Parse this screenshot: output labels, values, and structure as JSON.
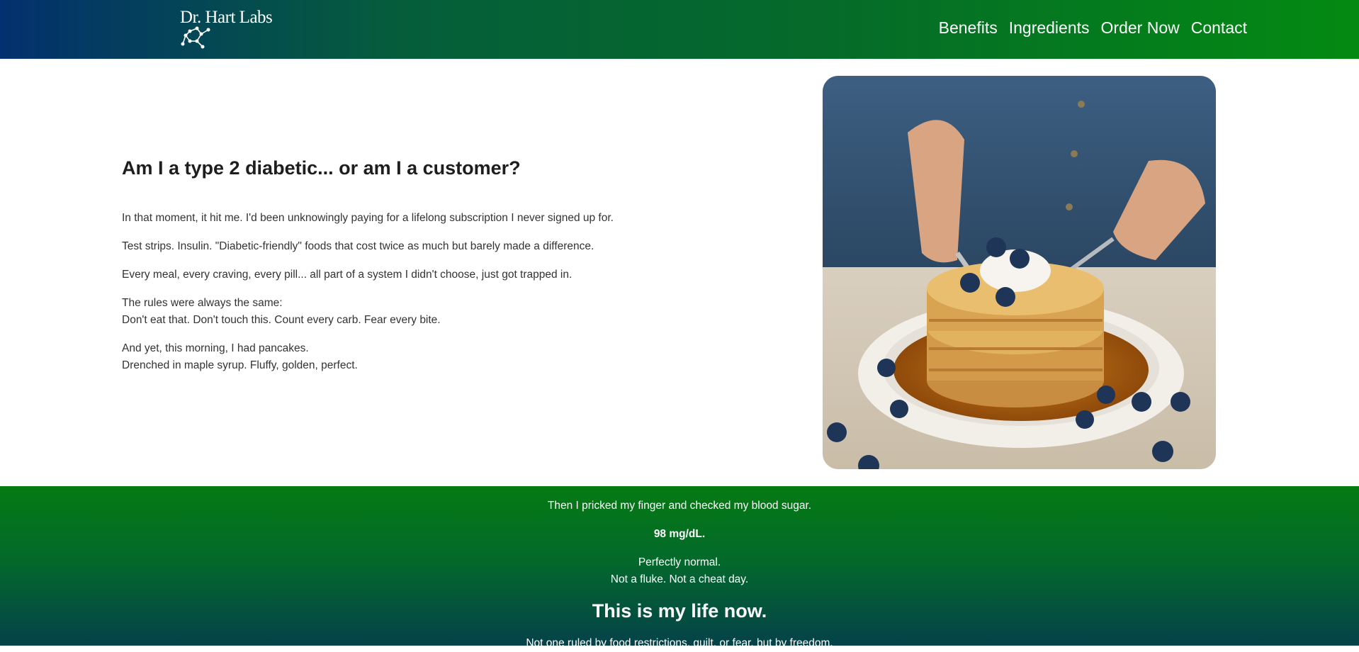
{
  "brand": {
    "logo_text": "Dr. Hart Labs",
    "colors": {
      "header_start": "#03306e",
      "header_end": "#048a12",
      "band_top": "#047a12",
      "band_bottom": "#04424a"
    }
  },
  "nav": {
    "items": [
      {
        "label": "Benefits"
      },
      {
        "label": "Ingredients"
      },
      {
        "label": "Order Now"
      },
      {
        "label": "Contact"
      }
    ]
  },
  "hero": {
    "title": "Am I a type 2 diabetic... or am I a customer?",
    "p1": "In that moment, it hit me. I'd been unknowingly paying for a lifelong subscription I never signed up for.",
    "p2": "Test strips. Insulin. \"Diabetic-friendly\" foods that cost twice as much but barely made a difference.",
    "p3": "Every meal, every craving, every pill... all part of a system I didn't choose, just got trapped in.",
    "p4_line1": "The rules were always the same:",
    "p4_line2": "Don't eat that. Don't touch this. Count every carb. Fear every bite.",
    "p5_line1": "And yet, this morning, I had pancakes.",
    "p5_line2": "Drenched in maple syrup. Fluffy, golden, perfect.",
    "image_icon": "pancakes-photo"
  },
  "band": {
    "line1": "Then I pricked my finger and checked my blood sugar.",
    "reading": "98 mg/dL.",
    "normal1": "Perfectly normal.",
    "normal2": "Not a fluke. Not a cheat day.",
    "headline": "This is my life now.",
    "tail": "Not one ruled by food restrictions, guilt, or fear, but by freedom."
  }
}
